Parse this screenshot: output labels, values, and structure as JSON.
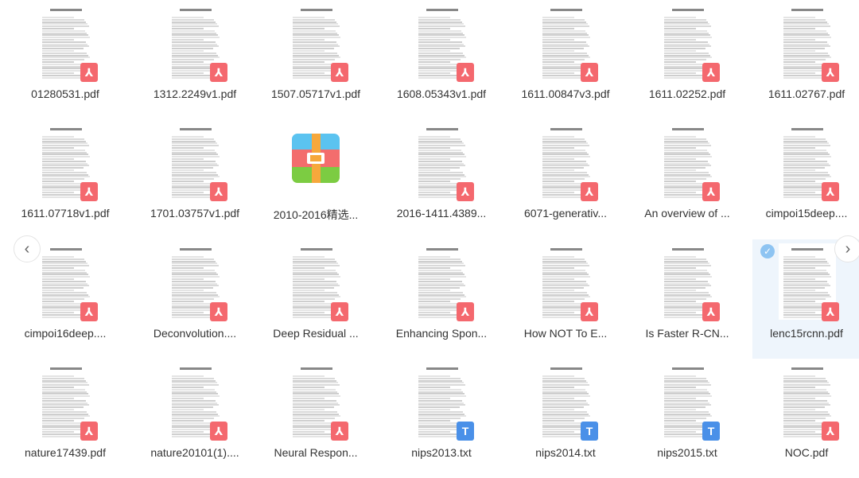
{
  "colors": {
    "pdf_badge": "#f4686e",
    "txt_badge": "#4a90e8",
    "selected_bg": "#eef5fc"
  },
  "navigation": {
    "prev_icon": "chevron-left-icon",
    "next_icon": "chevron-right-icon"
  },
  "files": [
    {
      "name": "01280531.pdf",
      "type": "pdf"
    },
    {
      "name": "1312.2249v1.pdf",
      "type": "pdf"
    },
    {
      "name": "1507.05717v1.pdf",
      "type": "pdf"
    },
    {
      "name": "1608.05343v1.pdf",
      "type": "pdf"
    },
    {
      "name": "1611.00847v3.pdf",
      "type": "pdf"
    },
    {
      "name": "1611.02252.pdf",
      "type": "pdf"
    },
    {
      "name": "1611.02767.pdf",
      "type": "pdf"
    },
    {
      "name": "1611.07718v1.pdf",
      "type": "pdf"
    },
    {
      "name": "1701.03757v1.pdf",
      "type": "pdf"
    },
    {
      "name": "2010-2016精选...",
      "type": "archive"
    },
    {
      "name": "2016-1411.4389...",
      "type": "pdf"
    },
    {
      "name": "6071-generativ...",
      "type": "pdf"
    },
    {
      "name": "An overview of ...",
      "type": "pdf"
    },
    {
      "name": "cimpoi15deep....",
      "type": "pdf"
    },
    {
      "name": "cimpoi16deep....",
      "type": "pdf"
    },
    {
      "name": "Deconvolution....",
      "type": "pdf"
    },
    {
      "name": "Deep Residual ...",
      "type": "pdf"
    },
    {
      "name": "Enhancing Spon...",
      "type": "pdf"
    },
    {
      "name": "How NOT To E...",
      "type": "pdf"
    },
    {
      "name": "Is Faster R-CN...",
      "type": "pdf"
    },
    {
      "name": "lenc15rcnn.pdf",
      "type": "pdf",
      "selected": true
    },
    {
      "name": "nature17439.pdf",
      "type": "pdf"
    },
    {
      "name": "nature20101(1)....",
      "type": "pdf"
    },
    {
      "name": "Neural Respon...",
      "type": "pdf"
    },
    {
      "name": "nips2013.txt",
      "type": "txt"
    },
    {
      "name": "nips2014.txt",
      "type": "txt"
    },
    {
      "name": "nips2015.txt",
      "type": "txt"
    },
    {
      "name": "NOC.pdf",
      "type": "pdf"
    }
  ]
}
